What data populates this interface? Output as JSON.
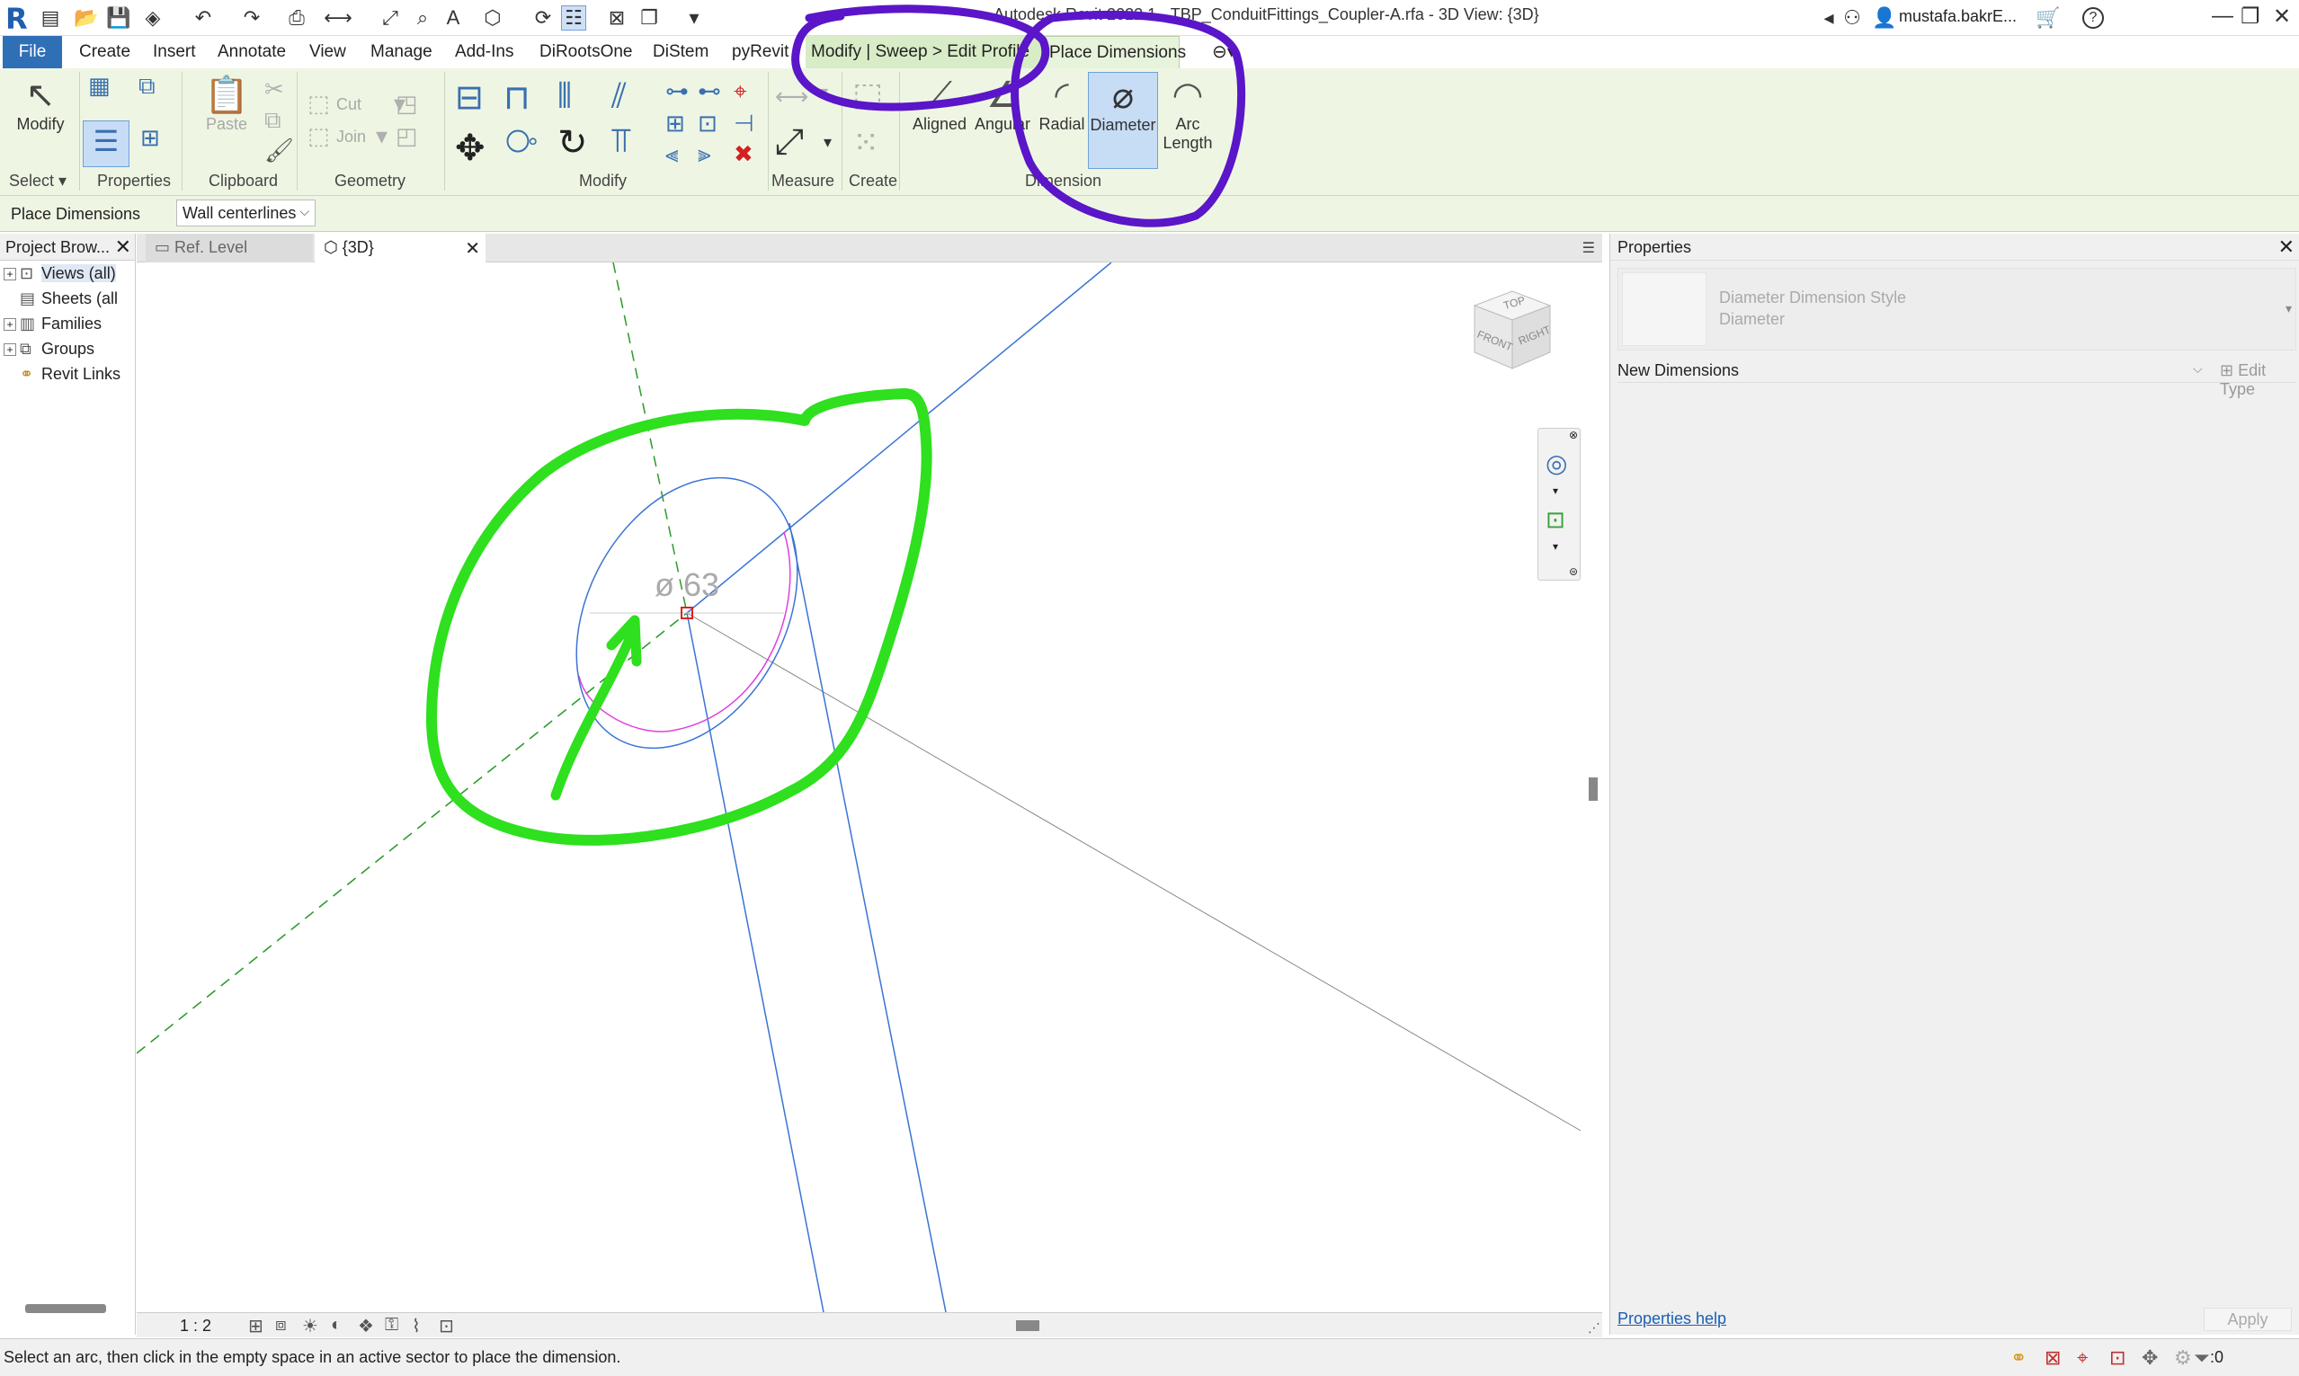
{
  "app": {
    "logo": "R",
    "window_title": "Autodesk Revit 2022.1 - TBP_ConduitFittings_Coupler-A.rfa - 3D View: {3D}",
    "user": "mustafa.bakrE...",
    "help": "?"
  },
  "tabs": [
    {
      "label": "File"
    },
    {
      "label": "Create"
    },
    {
      "label": "Insert"
    },
    {
      "label": "Annotate"
    },
    {
      "label": "View"
    },
    {
      "label": "Manage"
    },
    {
      "label": "Add-Ins"
    },
    {
      "label": "DiRootsOne"
    },
    {
      "label": "DiStem"
    },
    {
      "label": "pyRevit"
    },
    {
      "label": "Modify | Sweep > Edit Profile"
    },
    {
      "label": "Place Dimensions"
    }
  ],
  "ribbon": {
    "modify_label": "Modify",
    "paste_label": "Paste",
    "cut_label": "Cut",
    "join_label": "Join",
    "aligned_label": "Aligned",
    "angular_label": "Angular",
    "radial_label": "Radial",
    "diameter_label": "Diameter",
    "arc_label": "Arc",
    "arc_label2": "Length",
    "panels": {
      "select": "Select",
      "properties": "Properties",
      "clipboard": "Clipboard",
      "geometry": "Geometry",
      "modify": "Modify",
      "measure": "Measure",
      "create": "Create",
      "dimension": "Dimension"
    }
  },
  "options_bar": {
    "label": "Place Dimensions",
    "select_value": "Wall centerlines"
  },
  "browser": {
    "title": "Project Brow...",
    "items": [
      {
        "label": "Views (all)"
      },
      {
        "label": "Sheets (all"
      },
      {
        "label": "Families"
      },
      {
        "label": "Groups"
      },
      {
        "label": "Revit Links"
      }
    ]
  },
  "view_tabs": [
    {
      "label": "Ref. Level"
    },
    {
      "label": "{3D}"
    }
  ],
  "canvas": {
    "dimension_text": "ø 63",
    "viewcube": {
      "top": "TOP",
      "front": "FRONT",
      "right": "RIGHT"
    }
  },
  "view_control": {
    "scale": "1 : 2"
  },
  "properties": {
    "title": "Properties",
    "type_family": "Diameter Dimension Style",
    "type_name": "Diameter",
    "instance_label": "New Dimensions",
    "edit_type": "Edit Type",
    "help_link": "Properties help",
    "apply": "Apply"
  },
  "status": {
    "text": "Select an arc, then click in the empty space in an active sector to place the dimension.",
    "filter_count": ":0"
  },
  "colors": {
    "file_tab": "#2f6fb6",
    "context_tab": "#d8ecc7",
    "ribbon_bg": "#eef6e3",
    "annotation_green": "#2ee01e",
    "annotation_purple": "#5a16c8",
    "axis_blue": "#3b73d6"
  }
}
